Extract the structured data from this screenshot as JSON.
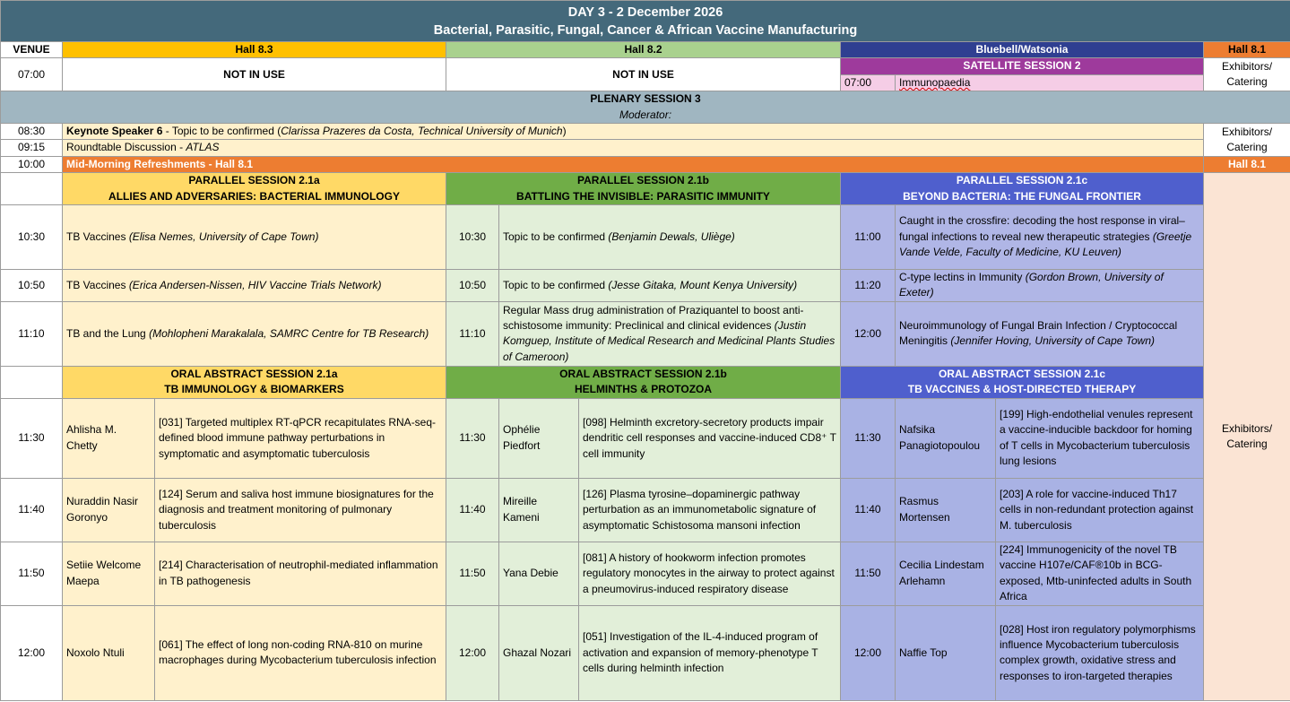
{
  "header": {
    "line1": "DAY 3 - 2 December 2026",
    "line2": "Bacterial, Parasitic, Fungal, Cancer & African Vaccine Manufacturing"
  },
  "venues": {
    "label": "VENUE",
    "hall83": "Hall 8.3",
    "hall82": "Hall 8.2",
    "bluebell": "Bluebell/Watsonia",
    "hall81": "Hall 8.1"
  },
  "early": {
    "time": "07:00",
    "hall83": "NOT IN USE",
    "hall82": "NOT IN USE",
    "satellite_title": "SATELLITE SESSION 2",
    "satellite_time": "07:00",
    "satellite_item": "Immunopaedia",
    "hall81": "Exhibitors/ Catering"
  },
  "plenary": {
    "title": "PLENARY SESSION 3",
    "moderator": "Moderator:",
    "rows": [
      {
        "time": "08:30",
        "bold": "Keynote Speaker 6",
        "rest": " - Topic to be confirmed (",
        "italic": "Clarissa Prazeres da Costa, Technical University of Munich",
        "close": ")"
      },
      {
        "time": "09:15",
        "rest": "Roundtable Discussion - ",
        "italic": "ATLAS"
      }
    ],
    "side": "Exhibitors/ Catering"
  },
  "refresh": {
    "time": "10:00",
    "text": "Mid-Morning Refreshments - Hall 8.1",
    "side": "Hall 8.1"
  },
  "parallel": {
    "a": {
      "title": "PARALLEL SESSION 2.1a",
      "sub": "ALLIES AND ADVERSARIES: BACTERIAL IMMUNOLOGY"
    },
    "b": {
      "title": "PARALLEL SESSION 2.1b",
      "sub": "BATTLING THE INVISIBLE: PARASITIC IMMUNITY"
    },
    "c": {
      "title": "PARALLEL SESSION 2.1c",
      "sub": "BEYOND BACTERIA: THE FUNGAL FRONTIER"
    },
    "rows": [
      {
        "time": "10:30",
        "a_text": "TB Vaccines ",
        "a_it": "(Elisa Nemes, University of Cape Town)",
        "b_time": "10:30",
        "b_text": "Topic to be confirmed ",
        "b_it": "(Benjamin Dewals, Uliège)",
        "c_time": "11:00",
        "c_text": "Caught in the crossfire: decoding the host response in viral–fungal infections to reveal new therapeutic strategies ",
        "c_it": "(Greetje Vande Velde, Faculty of Medicine, KU Leuven)"
      },
      {
        "time": "10:50",
        "a_text": "TB Vaccines ",
        "a_it": "(Erica Andersen-Nissen, HIV Vaccine Trials Network)",
        "b_time": "10:50",
        "b_text": "Topic to be confirmed ",
        "b_it": "(Jesse Gitaka, Mount Kenya University)",
        "c_time": "11:20",
        "c_text": "C-type lectins in Immunity ",
        "c_it": "(Gordon Brown, University of Exeter)"
      },
      {
        "time": "11:10",
        "a_text": "TB and the Lung ",
        "a_it": "(Mohlopheni Marakalala, SAMRC Centre for TB Research)",
        "b_time": "11:10",
        "b_text": "Regular Mass drug administration of Praziquantel to boost anti-schistosome immunity: Preclinical and clinical evidences ",
        "b_it": "(Justin Komguep, Institute of Medical Research and Medicinal Plants Studies of Cameroon)",
        "c_time": "12:00",
        "c_text": "Neuroimmunology of Fungal Brain Infection / Cryptococcal Meningitis ",
        "c_it": "(Jennifer Hoving, University of Cape Town)"
      }
    ]
  },
  "oral": {
    "a": {
      "title": "ORAL ABSTRACT SESSION 2.1a",
      "sub": "TB IMMUNOLOGY & BIOMARKERS"
    },
    "b": {
      "title": "ORAL ABSTRACT SESSION 2.1b",
      "sub": "HELMINTHS & PROTOZOA"
    },
    "c": {
      "title": "ORAL ABSTRACT SESSION 2.1c",
      "sub": "TB VACCINES & HOST-DIRECTED THERAPY"
    },
    "side": "Exhibitors/ Catering",
    "rows": [
      {
        "time": "11:30",
        "a_name": "Ahlisha M. Chetty",
        "a_title": "[031] Targeted multiplex RT-qPCR recapitulates RNA-seq-defined blood immune pathway perturbations in symptomatic and asymptomatic tuberculosis",
        "b_time": "11:30",
        "b_name": "Ophélie Piedfort",
        "b_title": "[098] Helminth excretory-secretory products impair dendritic cell responses and vaccine-induced CD8⁺ T cell immunity",
        "c_time": "11:30",
        "c_name": "Nafsika Panagiotopoulou",
        "c_title": "[199] High-endothelial venules represent a vaccine-inducible backdoor for homing of T cells in Mycobacterium tuberculosis lung lesions"
      },
      {
        "time": "11:40",
        "a_name": "Nuraddin Nasir Goronyo",
        "a_title": "[124] Serum and saliva host immune biosignatures for the diagnosis and treatment monitoring of pulmonary tuberculosis",
        "b_time": "11:40",
        "b_name": "Mireille Kameni",
        "b_title": "[126] Plasma tyrosine–dopaminergic pathway perturbation as an immunometabolic signature of asymptomatic Schistosoma mansoni infection",
        "c_time": "11:40",
        "c_name": "Rasmus Mortensen",
        "c_title": "[203] A role for vaccine-induced Th17 cells in non-redundant protection against M. tuberculosis"
      },
      {
        "time": "11:50",
        "a_name": "Setiie Welcome Maepa",
        "a_title": "[214] Characterisation of neutrophil-mediated inflammation in TB pathogenesis",
        "b_time": "11:50",
        "b_name": "Yana Debie",
        "b_title": "[081] A history of hookworm infection promotes regulatory monocytes in the airway to protect against a pneumovirus-induced respiratory disease",
        "c_time": "11:50",
        "c_name": "Cecilia Lindestam Arlehamn",
        "c_title": "[224] Immunogenicity of the novel TB vaccine H107e/CAF®10b in BCG-exposed, Mtb-uninfected adults in South Africa"
      },
      {
        "time": "12:00",
        "a_name": "Noxolo Ntuli",
        "a_title": "[061] The effect of long non-coding RNA-810 on murine macrophages during Mycobacterium tuberculosis infection",
        "b_time": "12:00",
        "b_name": "Ghazal Nozari",
        "b_title": "[051] Investigation of the IL-4-induced program of activation and expansion of memory-phenotype T cells during helminth infection",
        "c_time": "12:00",
        "c_name": "Naffie Top",
        "c_title": "[028] Host iron regulatory polymorphisms influence Mycobacterium tuberculosis complex growth, oxidative stress and responses to iron-targeted therapies"
      }
    ]
  },
  "colors": {
    "header": "#44697b",
    "hall83": "#ffc000",
    "hall82": "#a9d18e",
    "bluebell": "#2f3f91",
    "hall81": "#ed7d31",
    "satellite": "#9e3a9c",
    "plenary": "#a0b6c1",
    "cream": "#fff1cc",
    "green_light": "#e2efd9",
    "blue_light": "#b0b6e6",
    "peach": "#fbe4d4"
  }
}
